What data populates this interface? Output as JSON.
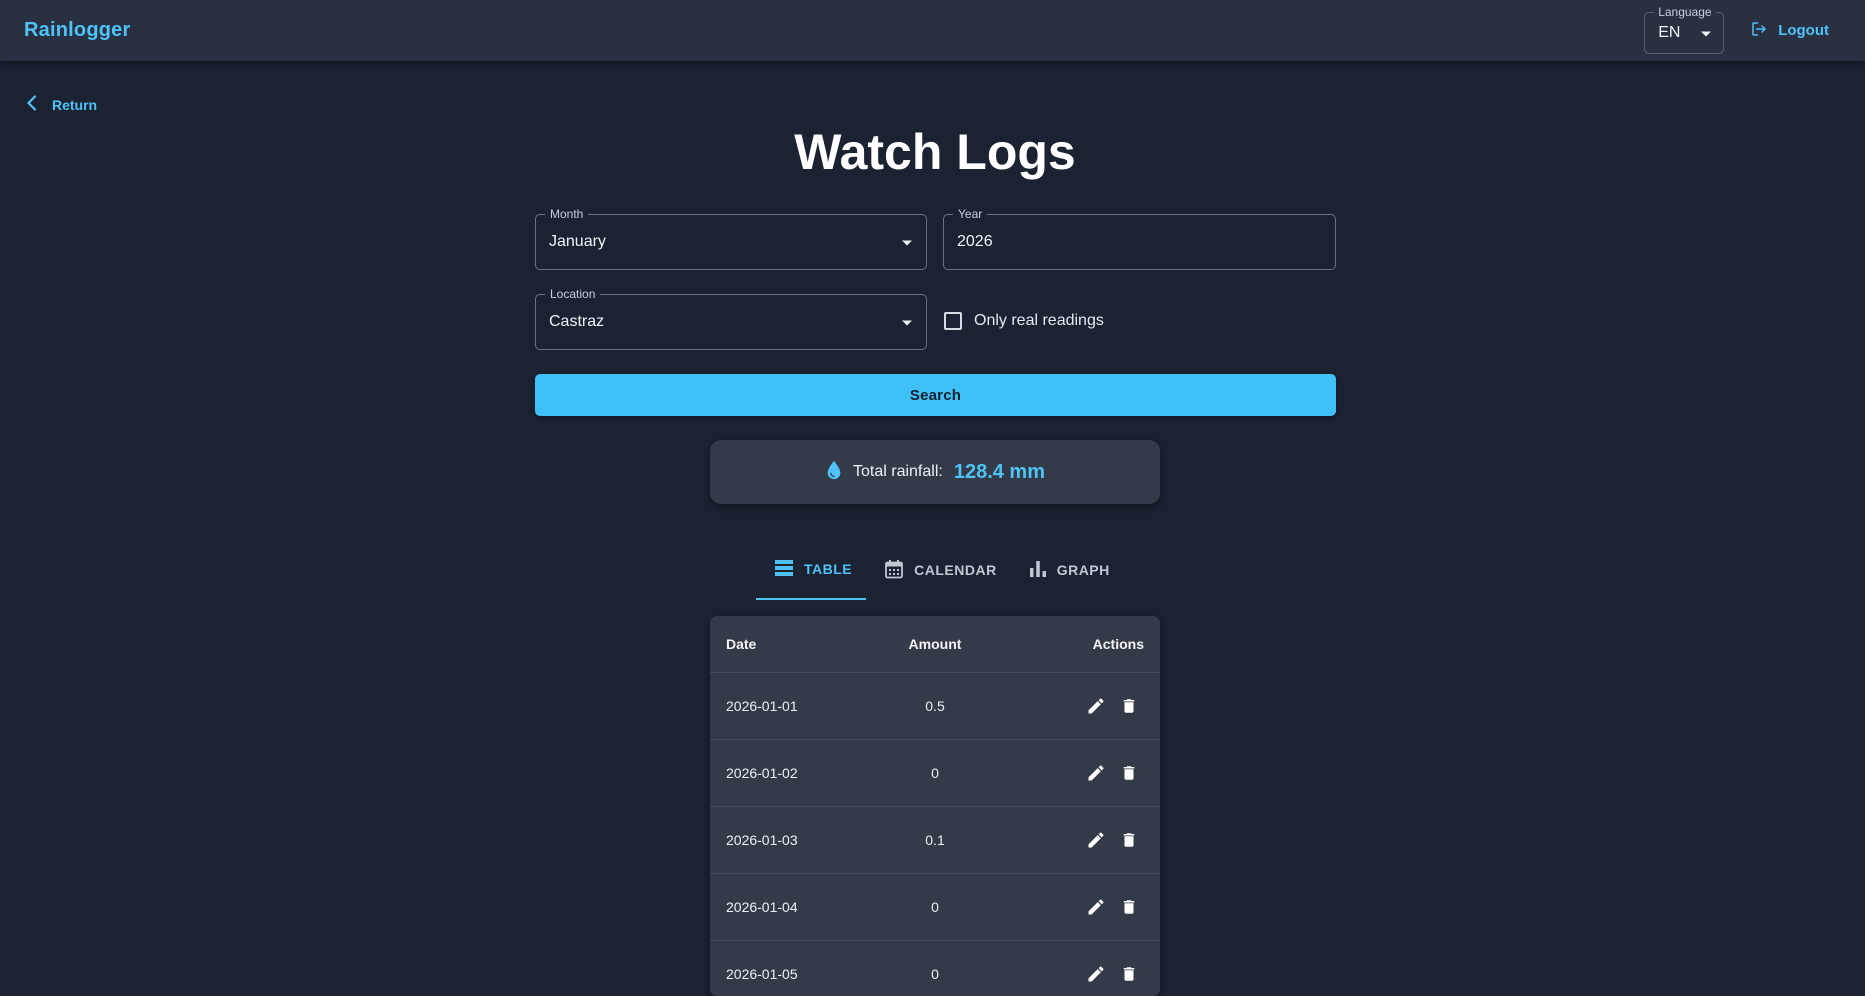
{
  "app": {
    "brand": "Rainlogger"
  },
  "header": {
    "language_label": "Language",
    "language_value": "EN",
    "logout_label": "Logout"
  },
  "nav": {
    "return_label": "Return"
  },
  "page": {
    "title": "Watch Logs"
  },
  "filters": {
    "month_label": "Month",
    "month_value": "January",
    "year_label": "Year",
    "year_value": "2026",
    "location_label": "Location",
    "location_value": "Castraz",
    "only_real_label": "Only real readings",
    "only_real_checked": false,
    "search_label": "Search"
  },
  "summary": {
    "total_label": "Total rainfall:",
    "total_value": "128.4 mm"
  },
  "tabs": [
    {
      "label": "TABLE",
      "icon": "table-icon",
      "active": true
    },
    {
      "label": "CALENDAR",
      "icon": "calendar-icon",
      "active": false
    },
    {
      "label": "GRAPH",
      "icon": "bar-chart-icon",
      "active": false
    }
  ],
  "table": {
    "headers": {
      "date": "Date",
      "amount": "Amount",
      "actions": "Actions"
    },
    "rows": [
      {
        "date": "2026-01-01",
        "amount": "0.5"
      },
      {
        "date": "2026-01-02",
        "amount": "0"
      },
      {
        "date": "2026-01-03",
        "amount": "0.1"
      },
      {
        "date": "2026-01-04",
        "amount": "0"
      },
      {
        "date": "2026-01-05",
        "amount": "0"
      }
    ]
  },
  "colors": {
    "accent": "#4fc3f7",
    "background": "#1b2232",
    "appbar": "#283041",
    "surface": "#343b48"
  }
}
